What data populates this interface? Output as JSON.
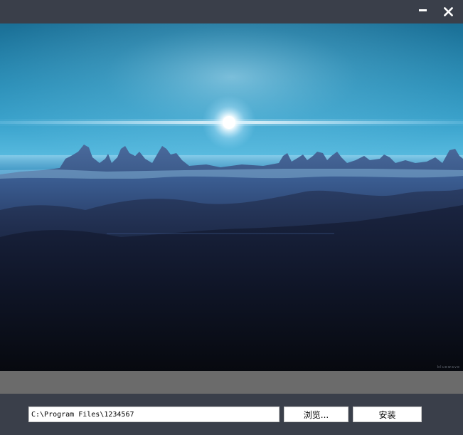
{
  "titlebar": {
    "minimize_icon": "minimize-icon",
    "close_icon": "close-icon",
    "close_glyph": "✕"
  },
  "hero": {
    "description_icon": "landscape-image",
    "watermark": "bluewave"
  },
  "progress": {
    "value": 0,
    "track_color": "#6b6b6b",
    "fill_color": "#3c8fd9"
  },
  "install": {
    "path_value": "C:\\Program Files\\1234567",
    "browse_label": "浏览...",
    "install_label": "安装"
  },
  "colors": {
    "window_bg": "#3a3f4a",
    "input_bg": "#ffffff"
  }
}
